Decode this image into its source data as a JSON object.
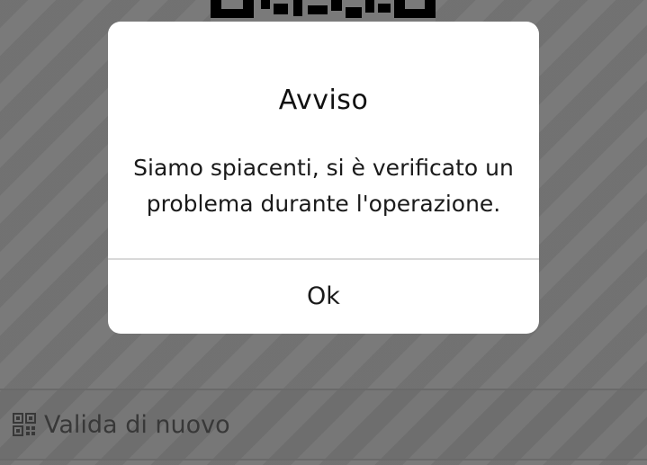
{
  "dialog": {
    "title": "Avviso",
    "message": "Siamo spiacenti, si è verificato un problema durante l'operazione.",
    "ok_label": "Ok"
  },
  "bottom_bar": {
    "revalidate_label": "Valida di nuovo",
    "revalidate_icon": "qr-code-icon"
  },
  "colors": {
    "overlay": "#7a7a7a",
    "dialog_bg": "#ffffff",
    "text": "#1a1a1a",
    "divider": "#d9d9d9"
  }
}
